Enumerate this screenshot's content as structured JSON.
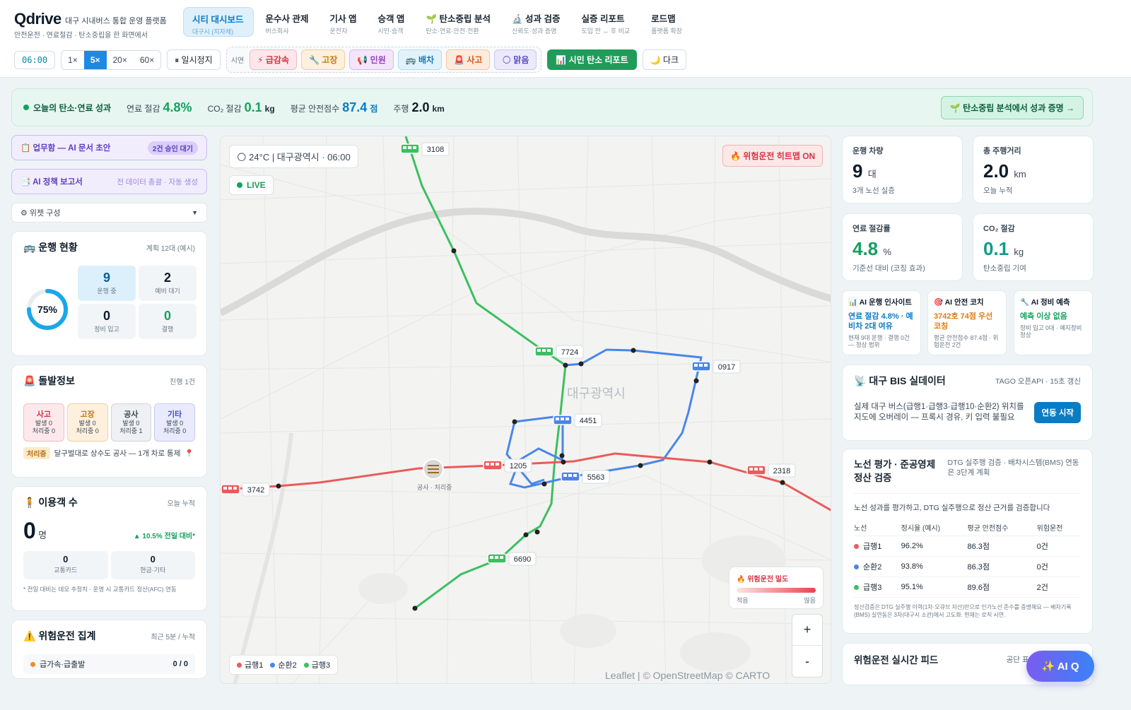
{
  "brand": {
    "logo": "Qdrive",
    "subtitle": "대구 시내버스 통합 운영 플랫폼",
    "tagline": "안전운전 · 연료절감 · 탄소중립을 한 화면에서"
  },
  "nav": [
    {
      "label": "시티 대시보드",
      "sub": "대구시 (지자체)"
    },
    {
      "label": "운수사 관제",
      "sub": "버스회사"
    },
    {
      "label": "기사 앱",
      "sub": "운전자"
    },
    {
      "label": "승객 앱",
      "sub": "시민·승객"
    },
    {
      "label": "🌱 탄소중립 분석",
      "sub": "탄소·연료·안전·전환"
    },
    {
      "label": "🔬 성과 검증",
      "sub": "신뢰도·성과 증명"
    },
    {
      "label": "실증 리포트",
      "sub": "도입 전 ↔ 후 비교"
    },
    {
      "label": "로드맵",
      "sub": "플랫폼 확장"
    }
  ],
  "controls": {
    "clock": "06:00",
    "speeds": [
      "1×",
      "5×",
      "20×",
      "60×"
    ],
    "pause": "⏸ 일시정지",
    "demo_label": "시연",
    "chips": [
      {
        "label": "⚡ 급감속",
        "bg": "#fde7ea",
        "fg": "#d63447",
        "bd": "#f5b7c0"
      },
      {
        "label": "🔧 고장",
        "bg": "#fdf0dd",
        "fg": "#c77a12",
        "bd": "#f3d09b"
      },
      {
        "label": "📢 민원",
        "bg": "#f3e6fb",
        "fg": "#9a3fc0",
        "bd": "#dcb7ef"
      },
      {
        "label": "🚌 배차",
        "bg": "#e2f2fb",
        "fg": "#1a7ab8",
        "bd": "#b2dcf2"
      },
      {
        "label": "🚨 사고",
        "bg": "#fdebde",
        "fg": "#d65a1c",
        "bd": "#f6c3a3"
      },
      {
        "label": "🌕 맑음",
        "bg": "#ece9fb",
        "fg": "#5a4bc0",
        "bd": "#cdc6f2"
      }
    ],
    "citizen_report": "📊 시민 탄소 리포트",
    "dark": "🌙 다크"
  },
  "banner": {
    "heading": "오늘의 탄소·연료 성과",
    "fuel_label": "연료 절감",
    "fuel_value": "4.8%",
    "co2_label": "CO₂ 절감",
    "co2_value": "0.1",
    "co2_unit": "kg",
    "safety_label": "평균 안전점수",
    "safety_value": "87.4",
    "safety_unit": "점",
    "dist_label": "주행",
    "dist_value": "2.0",
    "dist_unit": "km",
    "cta": "🌱 탄소중립 분석에서 성과 증명 →"
  },
  "left": {
    "doc_btn": "📋 업무함 — AI 문서 초안",
    "doc_pill": "2건 승인 대기",
    "policy_btn": "📑 AI 정책 보고서",
    "policy_sub": "전 데이터 총괄 · 자동 생성",
    "widget_sel": "⚙ 위젯 구성",
    "ops": {
      "title": "🚌 운행 현황",
      "meta": "계획 12대 (예시)",
      "pct": "75%",
      "pct_value": 75,
      "cells": [
        {
          "n": "9",
          "l": "운행 중"
        },
        {
          "n": "2",
          "l": "예비 대기"
        },
        {
          "n": "0",
          "l": "정비 입고"
        },
        {
          "n": "0",
          "l": "결행"
        }
      ]
    },
    "incident": {
      "title": "🚨 돌발정보",
      "meta": "진행 1건",
      "cards": [
        {
          "t": "사고",
          "a": "발생 0",
          "b": "처리중 0",
          "bg": "#fde9ec",
          "bd": "#f3bcc4",
          "fg": "#d63447"
        },
        {
          "t": "고장",
          "a": "발생 0",
          "b": "처리중 0",
          "bg": "#fdf1de",
          "bd": "#f1d19e",
          "fg": "#c77a12"
        },
        {
          "t": "공사",
          "a": "발생 0",
          "b": "처리중 1",
          "bg": "#eef0f3",
          "bd": "#cfd5dc",
          "fg": "#3a4856"
        },
        {
          "t": "기타",
          "a": "발생 0",
          "b": "처리중 0",
          "bg": "#e9ebfc",
          "bd": "#c4c9f4",
          "fg": "#4450c8"
        }
      ],
      "line_tag": "처리중",
      "line_text": "달구벌대로 상수도 공사 — 1개 차로 통제",
      "line_icon": "📍"
    },
    "pax": {
      "title": "🧍 이용객 수",
      "meta": "오늘 누적",
      "count": "0",
      "unit": "명",
      "delta": "▲ 10.5% 전일 대비*",
      "subs": [
        {
          "n": "0",
          "l": "교통카드"
        },
        {
          "n": "0",
          "l": "현금·기타"
        }
      ],
      "note": "* 전일 대비는 데모 추정치 · 운영 시 교통카드 정산(AFC) 연동"
    },
    "danger": {
      "title": "⚠️ 위험운전 집계",
      "meta": "최근 5분 / 누적",
      "row_label": "급가속·급출발",
      "row_value": "0 / 0"
    }
  },
  "map": {
    "weather": "🌕 24°C  |  대구광역시 · 06:00",
    "live": "LIVE",
    "heatmap": "🔥 위험운전 히트맵 ON",
    "city_label": "대구광역시",
    "construction": "공사 · 처리중",
    "buses": [
      "3108",
      "7724",
      "0917",
      "4451",
      "1205",
      "5563",
      "3742",
      "2318",
      "6690"
    ],
    "legend": [
      {
        "label": "급행1",
        "color": "#e95b5b"
      },
      {
        "label": "순환2",
        "color": "#4a86e8"
      },
      {
        "label": "급행3",
        "color": "#3cbf62"
      }
    ],
    "density": {
      "title": "🔥 위험운전 밀도",
      "low": "적음",
      "high": "많음"
    },
    "zoom_in": "+",
    "zoom_out": "-",
    "attribution": "Leaflet | © OpenStreetMap © CARTO"
  },
  "right": {
    "kpis": [
      {
        "label": "운행 차량",
        "value": "9",
        "unit": "대",
        "desc": "3개 노선 실증"
      },
      {
        "label": "총 주행거리",
        "value": "2.0",
        "unit": "km",
        "desc": "오늘 누적"
      },
      {
        "label": "연료 절감률",
        "value": "4.8",
        "unit": "%",
        "desc": "기준선 대비 (코칭 효과)"
      },
      {
        "label": "CO₂ 절감",
        "value": "0.1",
        "unit": "kg",
        "desc": "탄소중립 기여"
      }
    ],
    "ai": [
      {
        "h": "📊 AI 운행 인사이트",
        "m": "연료 절감 4.8% · 예비차 2대 여유",
        "s": "현재 9대 운행 · 결행 0건 — 정상 범위",
        "c": "#0a7cc4"
      },
      {
        "h": "🎯 AI 안전 코치",
        "m": "3742호 74점 우선 코칭",
        "s": "평균 안전점수 87.4점 · 위험운전 2건",
        "c": "#e07b12"
      },
      {
        "h": "🔧 AI 정비 예측",
        "m": "예측 이상 없음",
        "s": "정비 입고 0대 · 예지정비 정상",
        "c": "#17a05f"
      }
    ],
    "bis": {
      "title": "📡 대구 BIS 실데이터",
      "meta": "TAGO 오픈API · 15초 갱신",
      "desc": "실제 대구 버스(급행1·급행3·급행10·순환2) 위치를 지도에 오버레이 — 프록시 경유, 키 입력 불필요",
      "btn": "연동 시작"
    },
    "eval": {
      "title": "노선 평가 · 준공영제 정산 검증",
      "meta": "DTG 실주행 검증 · 배차시스템(BMS) 연동은 3단계 계획",
      "intro": "노선 성과를 평가하고, DTG 실주행으로 정산 근거를 검증합니다",
      "cols": [
        "노선",
        "정시율 (예시)",
        "평균 안전점수",
        "위험운전"
      ],
      "rows": [
        {
          "name": "급행1",
          "on_time": "96.2%",
          "score": "86.3점",
          "risk": "0건",
          "color": "#e95b5b"
        },
        {
          "name": "순환2",
          "on_time": "93.8%",
          "score": "86.3점",
          "risk": "0건",
          "color": "#4a86e8"
        },
        {
          "name": "급행3",
          "on_time": "95.1%",
          "score": "89.6점",
          "risk": "2건",
          "color": "#3cbf62"
        }
      ],
      "note": "정산검증은 DTG 실주행 이력(1차·오큐브 자산)만으로 인가노선 준수를 증명해요 — 배차기록(BMS) 실연동은 3차(대구시 소관)에서 고도화. 현재는 로직 시연."
    },
    "feed": {
      "title": "위험운전 실시간 피드",
      "meta": "공단 표준 위험운전 기준"
    }
  },
  "aiq": "✨ AI Q"
}
